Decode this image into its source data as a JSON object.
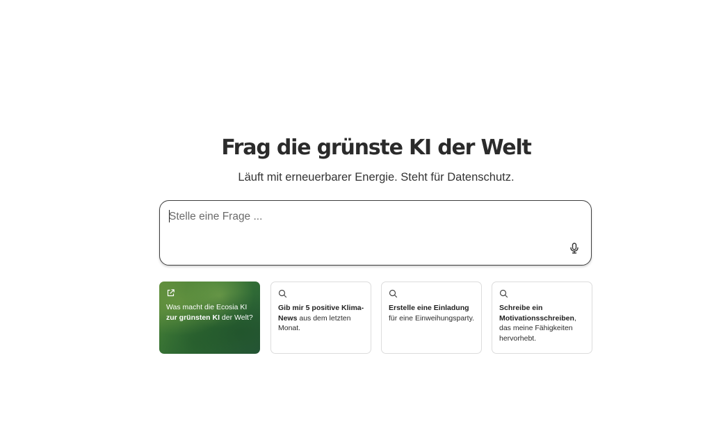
{
  "heading": {
    "title": "Frag die grünste KI der Welt",
    "subtitle": "Läuft mit erneuerbarer Energie. Steht für Datenschutz."
  },
  "search": {
    "placeholder": "Stelle eine Frage ...",
    "value": "",
    "mic_icon": "microphone-icon"
  },
  "suggestions": [
    {
      "icon": "external-link-icon",
      "text_before": "Was macht die Ecosia KI ",
      "bold": "zur grünsten KI",
      "text_after": " der Welt?"
    },
    {
      "icon": "search-icon",
      "text_before": "",
      "bold": "Gib mir 5 positive Klima-News",
      "text_after": " aus dem letzten Monat."
    },
    {
      "icon": "search-icon",
      "text_before": "",
      "bold": "Erstelle eine Einladung",
      "text_after": " für eine Einweihungsparty."
    },
    {
      "icon": "search-icon",
      "text_before": "",
      "bold": "Schreibe ein Motivationsschreiben",
      "text_after": ", das meine Fähigkeiten hervorhebt."
    }
  ],
  "colors": {
    "text": "#2b2b2b",
    "border": "#3d3d3d",
    "card_border": "#dcdcdc",
    "featured_green": "#3f7a36"
  }
}
